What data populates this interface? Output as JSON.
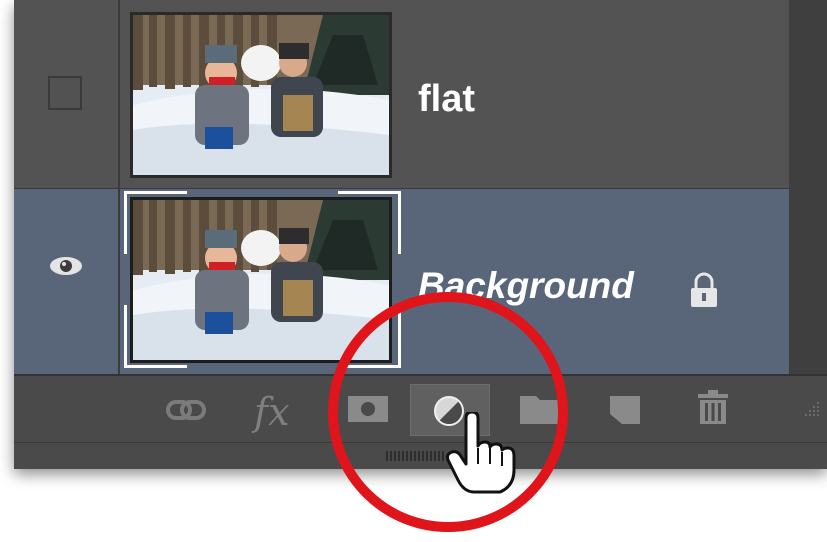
{
  "layers": [
    {
      "name": "flat",
      "visible": false,
      "locked": false,
      "selected": false
    },
    {
      "name": "Background",
      "visible": true,
      "locked": true,
      "selected": true
    }
  ],
  "toolbar": {
    "buttons": [
      {
        "icon": "link-icon",
        "label": ""
      },
      {
        "icon": "fx-icon",
        "label": "fx"
      },
      {
        "icon": "mask-icon",
        "label": ""
      },
      {
        "icon": "adjustment-layer-icon",
        "label": "",
        "active": true
      },
      {
        "icon": "folder-icon",
        "label": ""
      },
      {
        "icon": "new-layer-icon",
        "label": ""
      },
      {
        "icon": "trash-icon",
        "label": ""
      }
    ]
  },
  "colors": {
    "panel": "#535353",
    "selected_row": "#59667a",
    "highlight_circle": "#e0141b"
  }
}
